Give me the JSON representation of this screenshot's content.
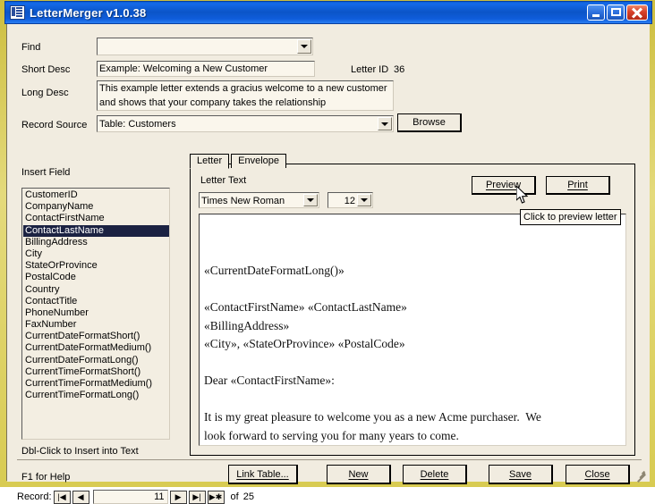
{
  "window": {
    "title": "LetterMerger v1.0.38",
    "icon": "app-grid-icon",
    "minimize_label": "Minimize",
    "maximize_label": "Maximize",
    "close_label": "Close",
    "frame_color": "#d8cb52",
    "titlebar_color": "#0b55c8",
    "client_color": "#f1ece0"
  },
  "form": {
    "find": {
      "label": "Find",
      "value": "",
      "placeholder": ""
    },
    "short_desc": {
      "label": "Short Desc",
      "value": "Example: Welcoming a New Customer"
    },
    "long_desc": {
      "label": "Long Desc",
      "value": "This example letter extends a gracius welcome to a new customer and shows that your company takes the relationship"
    },
    "record_source": {
      "label": "Record Source",
      "value": "Table: Customers"
    },
    "letter_id": {
      "label": "Letter ID",
      "value": "36"
    },
    "browse_button": "Browse"
  },
  "insert_field": {
    "label": "Insert Field",
    "hint": "Dbl-Click to Insert into Text",
    "selected": "ContactLastName",
    "items": [
      "CustomerID",
      "CompanyName",
      "ContactFirstName",
      "ContactLastName",
      "BillingAddress",
      "City",
      "StateOrProvince",
      "PostalCode",
      "Country",
      "ContactTitle",
      "PhoneNumber",
      "FaxNumber",
      "CurrentDateFormatShort()",
      "CurrentDateFormatMedium()",
      "CurrentDateFormatLong()",
      "CurrentTimeFormatShort()",
      "CurrentTimeFormatMedium()",
      "CurrentTimeFormatLong()"
    ]
  },
  "tabs": [
    {
      "label": "Letter",
      "active": true
    },
    {
      "label": "Envelope",
      "active": false
    }
  ],
  "letter_panel": {
    "letter_text_label": "Letter Text",
    "font_name": "Times New Roman",
    "font_size": "12",
    "preview_button": "Preview",
    "print_button": "Print",
    "tooltip": "Click to preview letter",
    "body": "«CurrentDateFormatLong()»\n\n«ContactFirstName» «ContactLastName»\n«BillingAddress»\n«City», «StateOrProvince» «PostalCode»\n\nDear «ContactFirstName»:\n\nIt is my great pleasure to welcome you as a new Acme purchaser.  We\nlook forward to serving you for many years to come."
  },
  "footer": {
    "help_text": "F1 for Help",
    "buttons": [
      "Link Table...",
      "New",
      "Delete",
      "Save",
      "Close"
    ]
  },
  "record_nav": {
    "label": "Record:",
    "first_icon": "first-record-icon",
    "prev_icon": "previous-record-icon",
    "next_icon": "next-record-icon",
    "last_icon": "last-record-icon",
    "new_icon": "new-record-icon",
    "current": "11",
    "of_label": "of",
    "total": "25"
  }
}
